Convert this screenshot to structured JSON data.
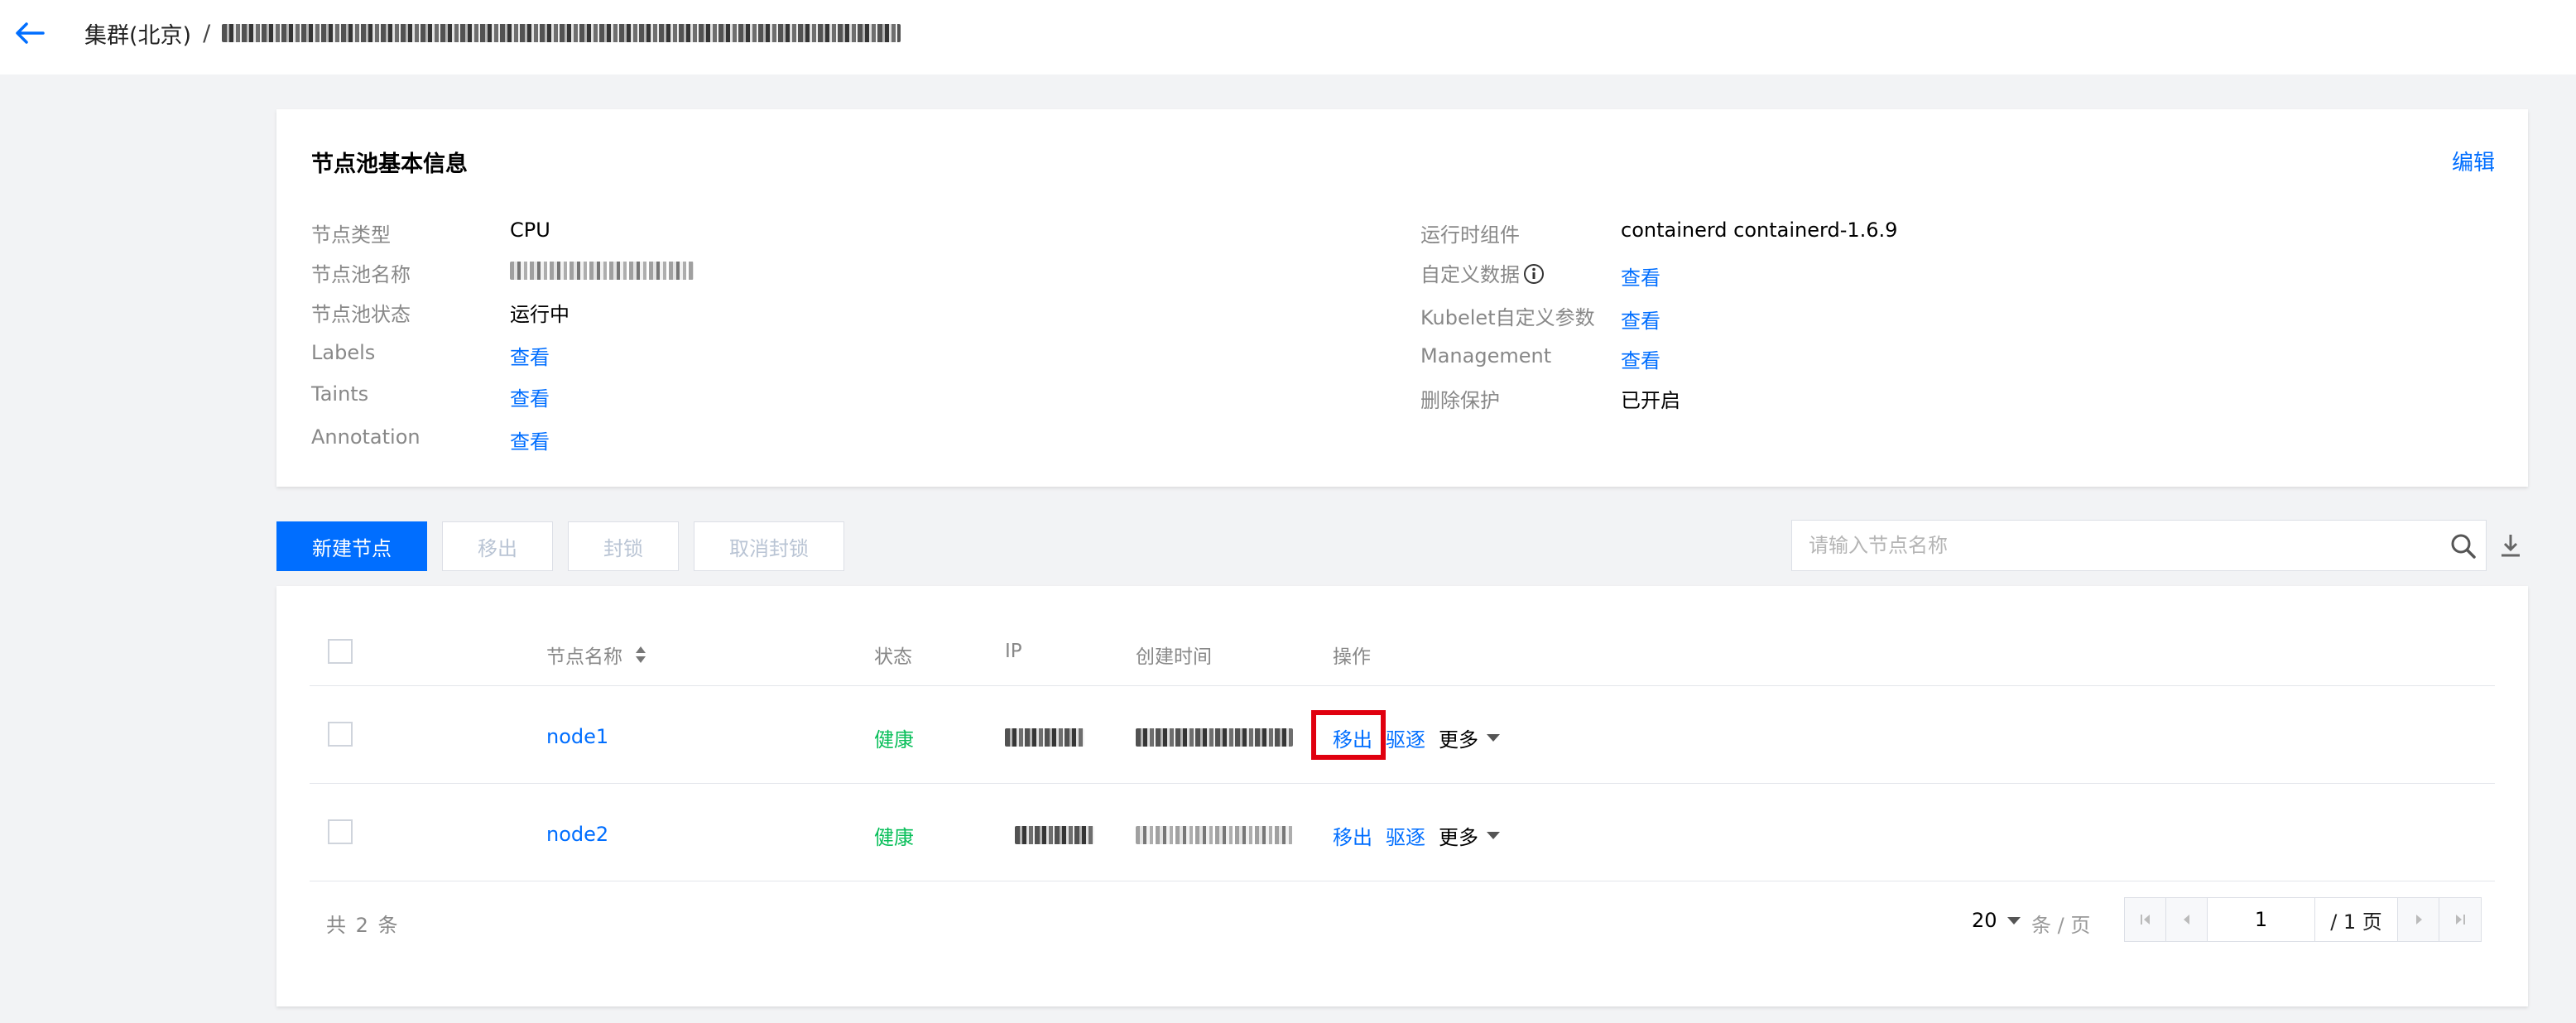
{
  "header": {
    "breadcrumb_root": "集群(北京)",
    "breadcrumb_sep": "/"
  },
  "info": {
    "title": "节点池基本信息",
    "edit": "编辑",
    "left": [
      {
        "key": "节点类型",
        "value": "CPU",
        "link": false
      },
      {
        "key": "节点池名称",
        "value": "",
        "link": false
      },
      {
        "key": "节点池状态",
        "value": "运行中",
        "link": false
      },
      {
        "key": "Labels",
        "value": "查看",
        "link": true
      },
      {
        "key": "Taints",
        "value": "查看",
        "link": true
      },
      {
        "key": "Annotation",
        "value": "查看",
        "link": true
      }
    ],
    "right": [
      {
        "key": "运行时组件",
        "value": "containerd containerd-1.6.9",
        "link": false
      },
      {
        "key": "自定义数据",
        "value": "查看",
        "link": true
      },
      {
        "key": "Kubelet自定义参数",
        "value": "查看",
        "link": true
      },
      {
        "key": "Management",
        "value": "查看",
        "link": true
      },
      {
        "key": "删除保护",
        "value": "已开启",
        "link": false
      }
    ]
  },
  "toolbar": {
    "create": "新建节点",
    "remove": "移出",
    "cordon": "封锁",
    "uncordon": "取消封锁",
    "search_placeholder": "请输入节点名称"
  },
  "table": {
    "columns": [
      "节点名称",
      "状态",
      "IP",
      "创建时间",
      "操作"
    ],
    "rows": [
      {
        "name": "node1",
        "status": "健康",
        "actions": [
          "移出",
          "驱逐",
          "更多"
        ]
      },
      {
        "name": "node2",
        "status": "健康",
        "actions": [
          "移出",
          "驱逐",
          "更多"
        ]
      }
    ],
    "total": "共 2 条",
    "page_size": "20",
    "page_unit": "条 / 页",
    "current_page": "1",
    "total_pages": "/ 1 页"
  },
  "colors": {
    "primary": "#006eff",
    "success": "#0abf5b",
    "highlight": "#e0000f"
  }
}
